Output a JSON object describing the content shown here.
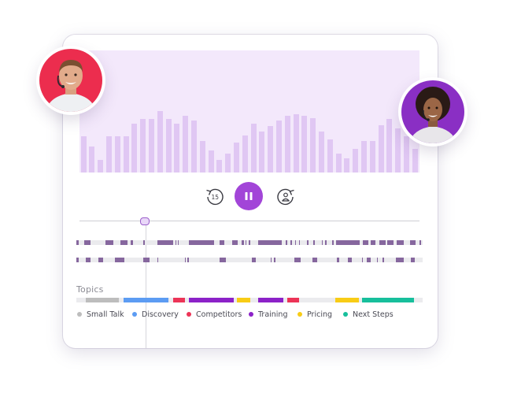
{
  "player": {
    "rewind_label": "15",
    "is_playing": true,
    "progress": 0.19
  },
  "topics": {
    "heading": "Topics",
    "items": [
      {
        "label": "Small Talk",
        "color": "#bdbdbd"
      },
      {
        "label": "Discovery",
        "color": "#5c9cf3"
      },
      {
        "label": "Competitors",
        "color": "#ec3457"
      },
      {
        "label": "Training",
        "color": "#8c22c8"
      },
      {
        "label": "Pricing",
        "color": "#f8cc16"
      },
      {
        "label": "Next Steps",
        "color": "#17bf9c"
      }
    ]
  },
  "colors": {
    "accent": "#a245d8",
    "waveform_bg": "#f3e8fb",
    "waveform_bar": "#e0c7f3",
    "speaker_segment": "#86679e",
    "avatar_left_bg": "#ec2d4e",
    "avatar_right_bg": "#8a2fc4"
  }
}
